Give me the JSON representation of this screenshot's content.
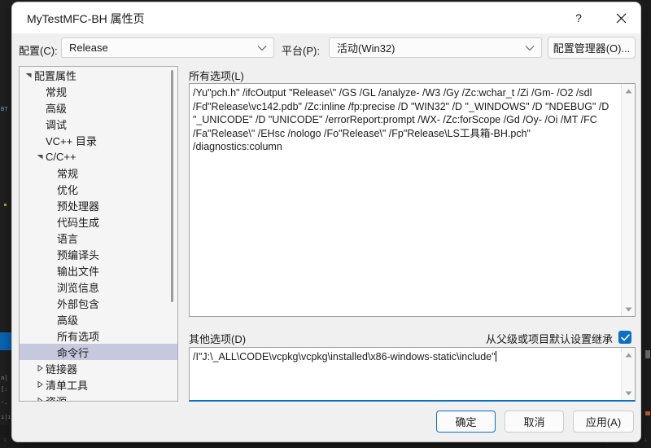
{
  "window": {
    "title": "MyTestMFC-BH 属性页",
    "help_icon": "?",
    "close_icon": "close-icon"
  },
  "header": {
    "config_label": "配置(C):",
    "config_value": "Release",
    "platform_label": "平台(P):",
    "platform_value": "活动(Win32)",
    "config_manager_button": "配置管理器(O)..."
  },
  "tree": [
    {
      "label": "配置属性",
      "indent": 0,
      "arrow": "expanded",
      "selected": false
    },
    {
      "label": "常规",
      "indent": 1,
      "arrow": "none",
      "selected": false
    },
    {
      "label": "高级",
      "indent": 1,
      "arrow": "none",
      "selected": false
    },
    {
      "label": "调试",
      "indent": 1,
      "arrow": "none",
      "selected": false
    },
    {
      "label": "VC++ 目录",
      "indent": 1,
      "arrow": "none",
      "selected": false
    },
    {
      "label": "C/C++",
      "indent": 1,
      "arrow": "expanded",
      "selected": false
    },
    {
      "label": "常规",
      "indent": 2,
      "arrow": "none",
      "selected": false
    },
    {
      "label": "优化",
      "indent": 2,
      "arrow": "none",
      "selected": false
    },
    {
      "label": "预处理器",
      "indent": 2,
      "arrow": "none",
      "selected": false
    },
    {
      "label": "代码生成",
      "indent": 2,
      "arrow": "none",
      "selected": false
    },
    {
      "label": "语言",
      "indent": 2,
      "arrow": "none",
      "selected": false
    },
    {
      "label": "预编译头",
      "indent": 2,
      "arrow": "none",
      "selected": false
    },
    {
      "label": "输出文件",
      "indent": 2,
      "arrow": "none",
      "selected": false
    },
    {
      "label": "浏览信息",
      "indent": 2,
      "arrow": "none",
      "selected": false
    },
    {
      "label": "外部包含",
      "indent": 2,
      "arrow": "none",
      "selected": false
    },
    {
      "label": "高级",
      "indent": 2,
      "arrow": "none",
      "selected": false
    },
    {
      "label": "所有选项",
      "indent": 2,
      "arrow": "none",
      "selected": false
    },
    {
      "label": "命令行",
      "indent": 2,
      "arrow": "none",
      "selected": true
    },
    {
      "label": "链接器",
      "indent": 1,
      "arrow": "collapsed",
      "selected": false
    },
    {
      "label": "清单工具",
      "indent": 1,
      "arrow": "collapsed",
      "selected": false
    },
    {
      "label": "资源",
      "indent": 1,
      "arrow": "collapsed",
      "selected": false
    }
  ],
  "main": {
    "all_options_label": "所有选项(L)",
    "all_options_value": "/Yu\"pch.h\" /ifcOutput \"Release\\\" /GS /GL /analyze- /W3 /Gy /Zc:wchar_t /Zi /Gm- /O2 /sdl /Fd\"Release\\vc142.pdb\" /Zc:inline /fp:precise /D \"WIN32\" /D \"_WINDOWS\" /D \"NDEBUG\" /D \"_UNICODE\" /D \"UNICODE\" /errorReport:prompt /WX- /Zc:forScope /Gd /Oy- /Oi /MT /FC /Fa\"Release\\\" /EHsc /nologo /Fo\"Release\\\" /Fp\"Release\\LS工具箱-BH.pch\" /diagnostics:column",
    "other_options_label": "其他选项(D)",
    "other_options_value": "/I\"J:\\_ALL\\CODE\\vcpkg\\vcpkg\\installed\\x86-windows-static\\include\"",
    "inherit_label": "从父级或项目默认设置继承",
    "inherit_checked": true
  },
  "footer": {
    "ok": "确定",
    "cancel": "取消",
    "apply": "应用(A)"
  },
  "colors": {
    "accent": "#0d6fc4",
    "selection": "#c6c9de",
    "dialog_bg": "#f0f0f0",
    "titlebar_bg": "#ffffff",
    "ide_bg": "#1e1e1e"
  }
}
